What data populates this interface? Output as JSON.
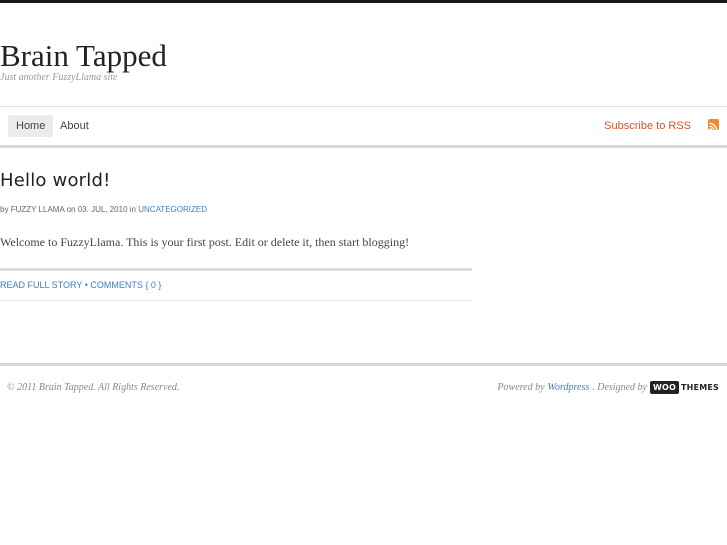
{
  "site": {
    "title": "Brain Tapped",
    "tagline": "Just another FuzzyLlama site"
  },
  "nav": {
    "items": [
      {
        "label": "Home",
        "active": true
      },
      {
        "label": "About",
        "active": false
      }
    ],
    "rss_label": "Subscribe to RSS",
    "rss_icon": "rss-feed-icon"
  },
  "post": {
    "title": "Hello world!",
    "meta": {
      "by": "by",
      "author": "FUZZY LLAMA",
      "on": "on",
      "date": "03. JUL, 2010",
      "in": "in",
      "category": "UNCATEGORIZED"
    },
    "body": "Welcome to FuzzyLlama. This is your first post. Edit or delete it, then start blogging!",
    "read_more": "READ FULL STORY",
    "separator": "•",
    "comments": "COMMENTS { 0 }"
  },
  "footer": {
    "copyright": "© 2011 Brain Tapped. All Rights Reserved.",
    "powered_by": "Powered by",
    "wordpress": "Wordpress",
    "designed_by": ". Designed by",
    "woo": "WOO",
    "themes": "THEMES"
  },
  "colors": {
    "link": "#3a7fc4",
    "rss": "#d9531e",
    "top_bar": "#1a1a1a"
  }
}
